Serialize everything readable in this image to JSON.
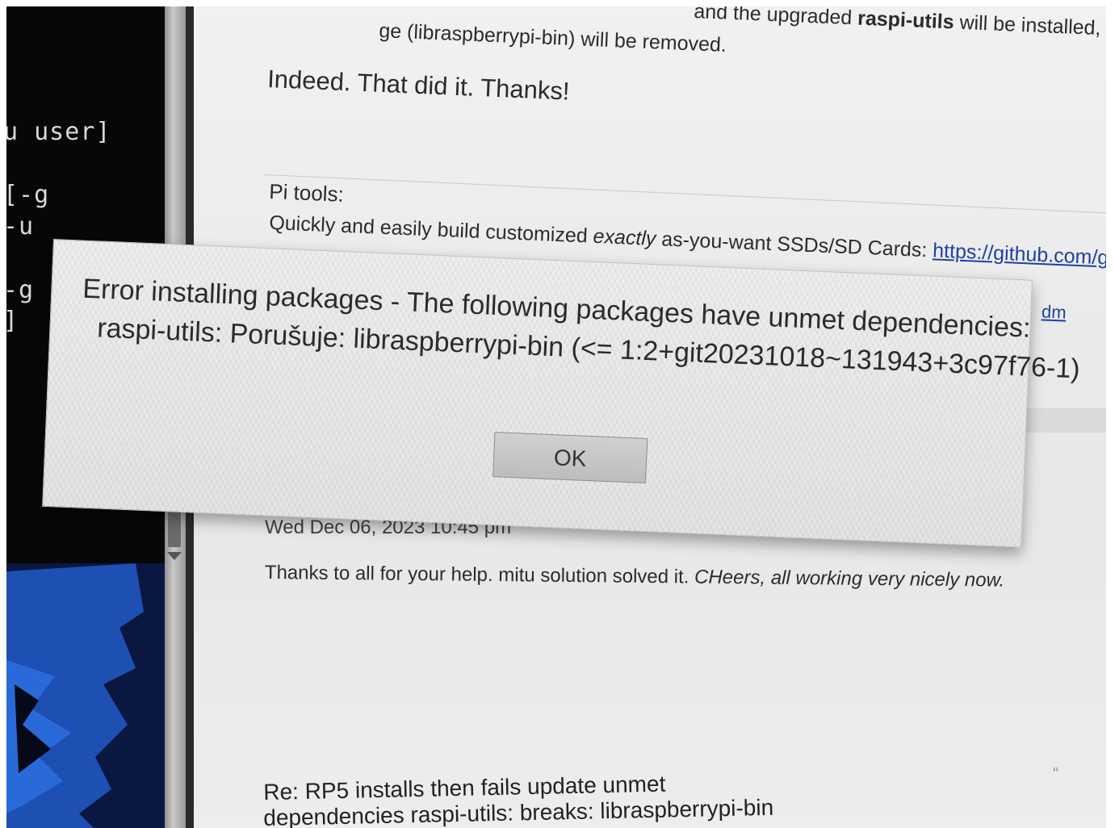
{
  "terminal": {
    "lines": [
      "u user]",
      "[-g",
      "-u",
      "-g",
      "]"
    ]
  },
  "page": {
    "partial_top": {
      "prefix": "ge (libraspberrypi-bin) will be removed.",
      "suffix": "and the upgraded ",
      "bold": "raspi-utils",
      "tail": " will be installed, w"
    },
    "reply_indeed": "Indeed. That did it. Thanks!",
    "signature": {
      "label": "Pi tools:",
      "text_before": "Quickly and easily build customized ",
      "text_italic": "exactly",
      "text_after": " as-you-want SSDs/SD Cards: ",
      "link": "https://github.com/gitbls/sdm",
      "link_wrap": "dm"
    },
    "post": {
      "date": "Wed Dec 06, 2023 10:45 pm",
      "body_plain": "Thanks to all for your help. mitu solution solved it. ",
      "body_italic": "CHeers, all working very nicely now."
    },
    "next_title_line1": "Re: RP5 installs then fails update unmet",
    "next_title_line2": "dependencies raspi-utils: breaks: libraspberrypi-bin",
    "quote_icon": "“"
  },
  "dialog": {
    "line1": "Error installing packages - The following packages have unmet dependencies:",
    "line2": "raspi-utils: Porušuje: libraspberrypi-bin (<= 1:2+git20231018~131943+3c97f76-1)",
    "ok_label": "OK"
  }
}
